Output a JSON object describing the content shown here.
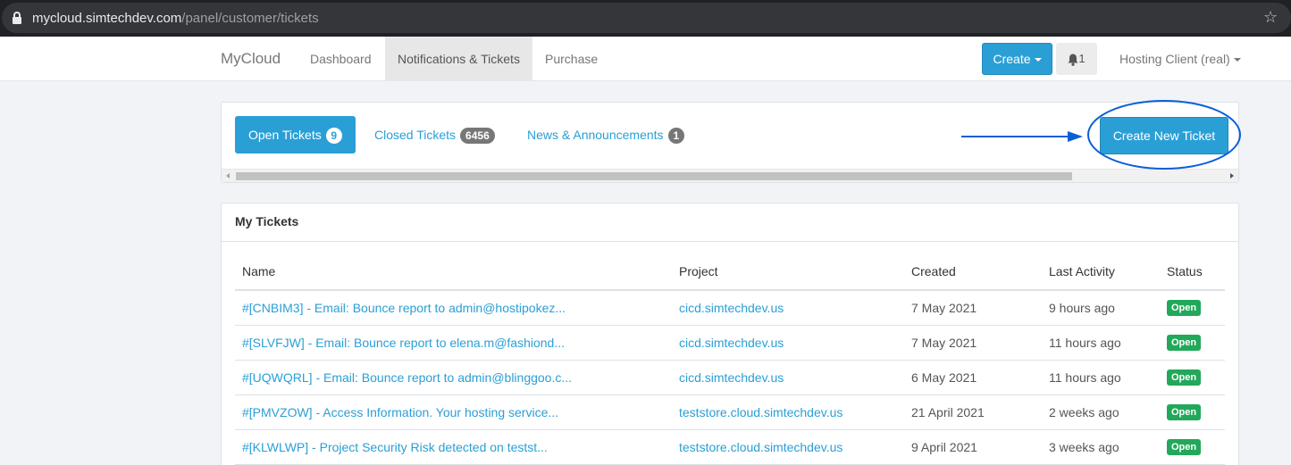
{
  "browser": {
    "url_host": "mycloud.simtechdev.com",
    "url_path": "/panel/customer/tickets",
    "icons": {
      "lock": "lock-icon",
      "bookmark": "star-icon"
    }
  },
  "navbar": {
    "brand": "MyCloud",
    "items": [
      {
        "label": "Dashboard"
      },
      {
        "label": "Notifications & Tickets",
        "active": true
      },
      {
        "label": "Purchase"
      }
    ],
    "create_label": "Create",
    "notifications_count": "1",
    "user_label": "Hosting Client (real)"
  },
  "tabs": [
    {
      "label": "Open Tickets",
      "count": "9",
      "active": true
    },
    {
      "label": "Closed Tickets",
      "count": "6456"
    },
    {
      "label": "News & Announcements",
      "count": "1"
    }
  ],
  "new_ticket_label": "Create New Ticket",
  "tickets": {
    "title": "My Tickets",
    "columns": [
      "Name",
      "Project",
      "Created",
      "Last Activity",
      "Status"
    ],
    "rows": [
      {
        "name": "#[CNBIM3] - Email: Bounce report to admin@hostipokez...",
        "project": "cicd.simtechdev.us",
        "created": "7 May 2021",
        "last_activity": "9 hours ago",
        "status": "Open"
      },
      {
        "name": "#[SLVFJW] - Email: Bounce report to elena.m@fashiond...",
        "project": "cicd.simtechdev.us",
        "created": "7 May 2021",
        "last_activity": "11 hours ago",
        "status": "Open"
      },
      {
        "name": "#[UQWQRL] - Email: Bounce report to admin@blinggoo.c...",
        "project": "cicd.simtechdev.us",
        "created": "6 May 2021",
        "last_activity": "11 hours ago",
        "status": "Open"
      },
      {
        "name": "#[PMVZOW] - Access Information. Your hosting service...",
        "project": "teststore.cloud.simtechdev.us",
        "created": "21 April 2021",
        "last_activity": "2 weeks ago",
        "status": "Open"
      },
      {
        "name": "#[KLWLWP] - Project Security Risk detected on testst...",
        "project": "teststore.cloud.simtechdev.us",
        "created": "9 April 2021",
        "last_activity": "3 weeks ago",
        "status": "Open"
      }
    ]
  },
  "colors": {
    "primary": "#2a9fd6",
    "success": "#22a85a",
    "annotation": "#0a5fd8"
  }
}
